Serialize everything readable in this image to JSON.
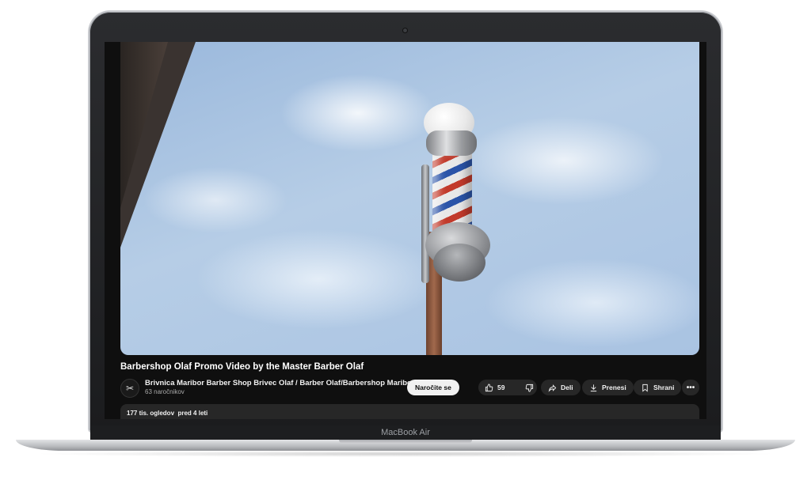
{
  "video": {
    "title": "Barbershop Olaf Promo Video by the Master Barber Olaf"
  },
  "channel": {
    "name": "Brivnica Maribor Barber Shop Brivec Olaf / Barber Olaf/Barbershop Maribor",
    "subscribers": "63 naročnikov",
    "subscribe_label": "Naročite se"
  },
  "actions": {
    "like_count": "59",
    "share_label": "Deli",
    "download_label": "Prenesi",
    "save_label": "Shrani",
    "more_label": "•••"
  },
  "description": {
    "views": "177 tis. ogledov",
    "age": "pred 4 leti"
  },
  "device": {
    "brand_label": "MacBook Air"
  }
}
